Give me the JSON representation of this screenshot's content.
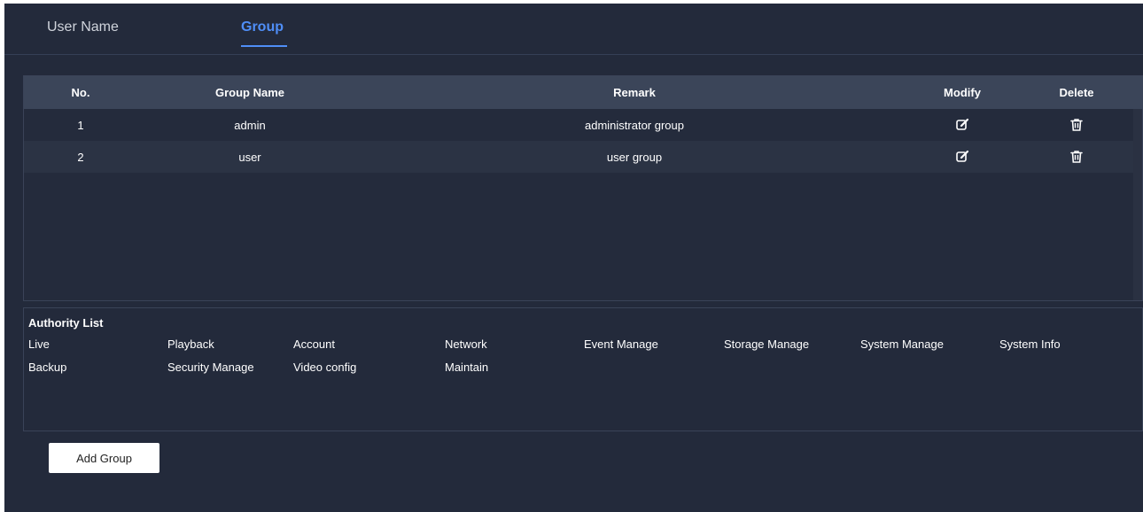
{
  "tabs": [
    {
      "label": "User Name",
      "active": false
    },
    {
      "label": "Group",
      "active": true
    }
  ],
  "table": {
    "headers": {
      "no": "No.",
      "group_name": "Group Name",
      "remark": "Remark",
      "modify": "Modify",
      "delete": "Delete"
    },
    "rows": [
      {
        "no": "1",
        "group_name": "admin",
        "remark": "administrator group",
        "modify_icon": "edit-icon",
        "delete_icon": "trash-icon"
      },
      {
        "no": "2",
        "group_name": "user",
        "remark": "user group",
        "modify_icon": "edit-icon",
        "delete_icon": "trash-icon"
      }
    ]
  },
  "authority": {
    "title": "Authority List",
    "items": [
      "Live",
      "Playback",
      "Account",
      "Network",
      "Event Manage",
      "Storage Manage",
      "System Manage",
      "System Info",
      "Backup",
      "Security Manage",
      "Video config",
      "Maintain"
    ]
  },
  "actions": {
    "add_group_label": "Add Group"
  },
  "colors": {
    "background": "#232a3b",
    "header_bg": "#3b4559",
    "accent": "#4f8ef7",
    "text": "#ffffff"
  }
}
